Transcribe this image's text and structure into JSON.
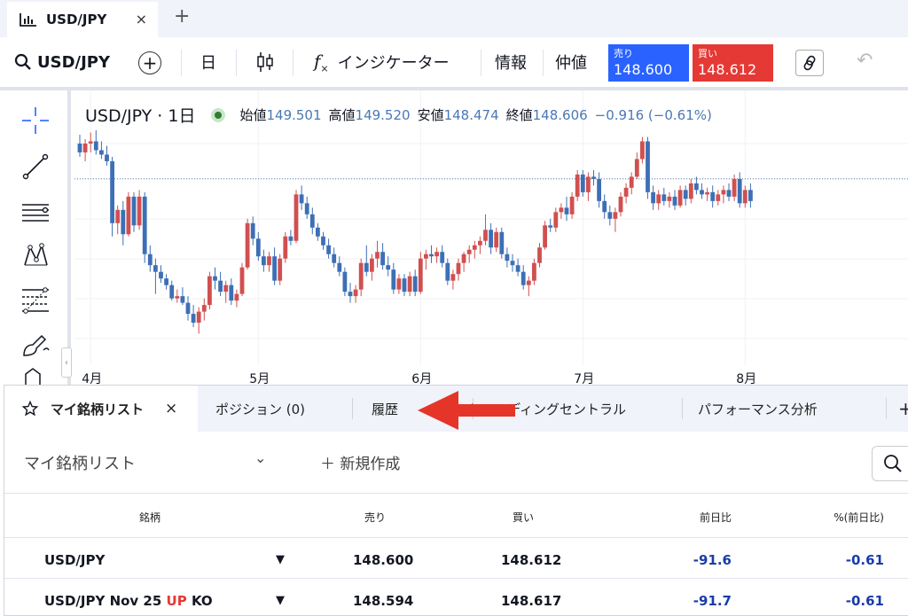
{
  "tab": {
    "title": "USD/JPY",
    "close": "×",
    "add": "+"
  },
  "toolbar": {
    "symbol": "USD/JPY",
    "add_symbol": "+",
    "interval": "日",
    "indicators": "インジケーター",
    "info": "情報",
    "mid": "仲値",
    "sell_label": "売り",
    "sell_price": "148.600",
    "buy_label": "買い",
    "buy_price": "148.612",
    "undo": "↶"
  },
  "legend": {
    "symbol": "USD/JPY · 1日",
    "open_label": "始値",
    "open": "149.501",
    "high_label": "高値",
    "high": "149.520",
    "low_label": "安値",
    "low": "148.474",
    "close_label": "終値",
    "close": "148.606",
    "change": "−0.916 (−0.61%)"
  },
  "colors": {
    "up": "#d0504f",
    "down": "#3d6fb6",
    "accent": "#2962ff",
    "sell_bg": "#2962ff",
    "buy_bg": "#e53935"
  },
  "chart_data": {
    "type": "candlestick",
    "x_tick_labels": [
      "4月",
      "5月",
      "6月",
      "7月",
      "8月"
    ],
    "x_tick_index": [
      2,
      33,
      63,
      93,
      123
    ],
    "price_line": 148.606,
    "ylim": [
      140.5,
      151.0
    ],
    "candles": [
      {
        "o": 150.2,
        "h": 150.6,
        "l": 149.6,
        "c": 149.8
      },
      {
        "o": 149.8,
        "h": 150.4,
        "l": 149.4,
        "c": 150.2
      },
      {
        "o": 150.2,
        "h": 150.7,
        "l": 149.8,
        "c": 150.3
      },
      {
        "o": 150.3,
        "h": 150.8,
        "l": 149.7,
        "c": 149.9
      },
      {
        "o": 149.9,
        "h": 150.3,
        "l": 149.5,
        "c": 149.7
      },
      {
        "o": 149.7,
        "h": 150.1,
        "l": 149.2,
        "c": 149.4
      },
      {
        "o": 149.4,
        "h": 149.6,
        "l": 146.0,
        "c": 146.6
      },
      {
        "o": 146.6,
        "h": 147.4,
        "l": 146.1,
        "c": 147.2
      },
      {
        "o": 147.2,
        "h": 147.6,
        "l": 145.6,
        "c": 146.1
      },
      {
        "o": 146.1,
        "h": 148.0,
        "l": 146.0,
        "c": 147.8
      },
      {
        "o": 147.8,
        "h": 148.0,
        "l": 146.2,
        "c": 146.5
      },
      {
        "o": 146.5,
        "h": 148.1,
        "l": 146.3,
        "c": 147.8
      },
      {
        "o": 147.8,
        "h": 148.0,
        "l": 144.8,
        "c": 145.2
      },
      {
        "o": 145.2,
        "h": 145.6,
        "l": 144.4,
        "c": 144.7
      },
      {
        "o": 144.7,
        "h": 145.0,
        "l": 143.4,
        "c": 144.4
      },
      {
        "o": 144.4,
        "h": 144.7,
        "l": 143.9,
        "c": 144.1
      },
      {
        "o": 144.1,
        "h": 144.3,
        "l": 143.6,
        "c": 143.8
      },
      {
        "o": 143.8,
        "h": 144.0,
        "l": 143.1,
        "c": 143.2
      },
      {
        "o": 143.2,
        "h": 143.6,
        "l": 143.0,
        "c": 143.3
      },
      {
        "o": 143.3,
        "h": 143.7,
        "l": 142.9,
        "c": 143.0
      },
      {
        "o": 143.0,
        "h": 143.3,
        "l": 142.2,
        "c": 142.5
      },
      {
        "o": 142.5,
        "h": 142.9,
        "l": 141.9,
        "c": 142.1
      },
      {
        "o": 142.1,
        "h": 142.8,
        "l": 141.6,
        "c": 142.6
      },
      {
        "o": 142.6,
        "h": 143.2,
        "l": 142.2,
        "c": 142.9
      },
      {
        "o": 142.9,
        "h": 144.4,
        "l": 142.7,
        "c": 144.2
      },
      {
        "o": 144.2,
        "h": 144.6,
        "l": 143.6,
        "c": 144.0
      },
      {
        "o": 144.0,
        "h": 144.4,
        "l": 143.3,
        "c": 143.5
      },
      {
        "o": 143.5,
        "h": 144.0,
        "l": 143.0,
        "c": 143.8
      },
      {
        "o": 143.8,
        "h": 144.1,
        "l": 142.9,
        "c": 143.1
      },
      {
        "o": 143.1,
        "h": 143.6,
        "l": 142.8,
        "c": 143.4
      },
      {
        "o": 143.4,
        "h": 144.8,
        "l": 143.3,
        "c": 144.6
      },
      {
        "o": 144.6,
        "h": 146.8,
        "l": 144.5,
        "c": 146.6
      },
      {
        "o": 146.6,
        "h": 146.9,
        "l": 145.6,
        "c": 145.9
      },
      {
        "o": 145.9,
        "h": 146.2,
        "l": 144.9,
        "c": 145.1
      },
      {
        "o": 145.1,
        "h": 145.4,
        "l": 144.4,
        "c": 144.7
      },
      {
        "o": 144.7,
        "h": 145.3,
        "l": 144.4,
        "c": 145.1
      },
      {
        "o": 145.1,
        "h": 145.5,
        "l": 143.8,
        "c": 144.0
      },
      {
        "o": 144.0,
        "h": 145.2,
        "l": 143.8,
        "c": 145.0
      },
      {
        "o": 145.0,
        "h": 146.2,
        "l": 144.8,
        "c": 146.0
      },
      {
        "o": 146.0,
        "h": 146.3,
        "l": 145.6,
        "c": 145.8
      },
      {
        "o": 145.8,
        "h": 148.1,
        "l": 145.7,
        "c": 147.9
      },
      {
        "o": 147.9,
        "h": 148.3,
        "l": 147.2,
        "c": 147.5
      },
      {
        "o": 147.5,
        "h": 147.8,
        "l": 146.8,
        "c": 147.0
      },
      {
        "o": 147.0,
        "h": 147.3,
        "l": 146.1,
        "c": 146.4
      },
      {
        "o": 146.4,
        "h": 146.6,
        "l": 145.8,
        "c": 146.0
      },
      {
        "o": 146.0,
        "h": 146.2,
        "l": 145.4,
        "c": 145.6
      },
      {
        "o": 145.6,
        "h": 145.9,
        "l": 145.0,
        "c": 145.2
      },
      {
        "o": 145.2,
        "h": 145.5,
        "l": 144.6,
        "c": 144.8
      },
      {
        "o": 144.8,
        "h": 145.1,
        "l": 144.2,
        "c": 144.4
      },
      {
        "o": 144.4,
        "h": 144.6,
        "l": 143.3,
        "c": 143.5
      },
      {
        "o": 143.5,
        "h": 143.9,
        "l": 143.0,
        "c": 143.3
      },
      {
        "o": 143.3,
        "h": 143.8,
        "l": 143.0,
        "c": 143.6
      },
      {
        "o": 143.6,
        "h": 145.0,
        "l": 143.3,
        "c": 144.8
      },
      {
        "o": 144.8,
        "h": 145.6,
        "l": 144.2,
        "c": 144.4
      },
      {
        "o": 144.4,
        "h": 145.2,
        "l": 144.0,
        "c": 145.0
      },
      {
        "o": 145.0,
        "h": 145.8,
        "l": 144.6,
        "c": 145.3
      },
      {
        "o": 145.3,
        "h": 145.7,
        "l": 144.5,
        "c": 144.7
      },
      {
        "o": 144.7,
        "h": 145.1,
        "l": 144.2,
        "c": 144.5
      },
      {
        "o": 144.5,
        "h": 144.8,
        "l": 143.4,
        "c": 143.6
      },
      {
        "o": 143.6,
        "h": 144.3,
        "l": 143.4,
        "c": 144.1
      },
      {
        "o": 144.1,
        "h": 144.3,
        "l": 143.3,
        "c": 143.5
      },
      {
        "o": 143.5,
        "h": 144.4,
        "l": 143.3,
        "c": 144.2
      },
      {
        "o": 144.2,
        "h": 144.5,
        "l": 143.3,
        "c": 143.5
      },
      {
        "o": 143.5,
        "h": 145.3,
        "l": 143.4,
        "c": 145.0
      },
      {
        "o": 145.0,
        "h": 145.4,
        "l": 144.5,
        "c": 145.2
      },
      {
        "o": 145.2,
        "h": 145.6,
        "l": 144.8,
        "c": 145.1
      },
      {
        "o": 145.1,
        "h": 145.5,
        "l": 144.8,
        "c": 145.3
      },
      {
        "o": 145.3,
        "h": 145.6,
        "l": 144.6,
        "c": 144.8
      },
      {
        "o": 144.8,
        "h": 145.0,
        "l": 143.8,
        "c": 144.0
      },
      {
        "o": 144.0,
        "h": 144.5,
        "l": 143.6,
        "c": 144.3
      },
      {
        "o": 144.3,
        "h": 145.0,
        "l": 144.0,
        "c": 144.8
      },
      {
        "o": 144.8,
        "h": 145.3,
        "l": 144.4,
        "c": 145.2
      },
      {
        "o": 145.2,
        "h": 145.6,
        "l": 144.8,
        "c": 145.4
      },
      {
        "o": 145.4,
        "h": 145.8,
        "l": 145.0,
        "c": 145.6
      },
      {
        "o": 145.6,
        "h": 146.0,
        "l": 145.2,
        "c": 145.8
      },
      {
        "o": 145.8,
        "h": 147.0,
        "l": 145.6,
        "c": 146.3
      },
      {
        "o": 146.3,
        "h": 146.6,
        "l": 145.2,
        "c": 145.5
      },
      {
        "o": 145.5,
        "h": 146.4,
        "l": 145.3,
        "c": 146.2
      },
      {
        "o": 146.2,
        "h": 146.4,
        "l": 145.0,
        "c": 145.2
      },
      {
        "o": 145.2,
        "h": 145.5,
        "l": 144.6,
        "c": 144.9
      },
      {
        "o": 144.9,
        "h": 145.2,
        "l": 144.4,
        "c": 144.7
      },
      {
        "o": 144.7,
        "h": 145.0,
        "l": 144.2,
        "c": 144.4
      },
      {
        "o": 144.4,
        "h": 144.7,
        "l": 143.6,
        "c": 143.8
      },
      {
        "o": 143.8,
        "h": 144.2,
        "l": 143.3,
        "c": 144.0
      },
      {
        "o": 144.0,
        "h": 145.0,
        "l": 143.8,
        "c": 144.8
      },
      {
        "o": 144.8,
        "h": 145.7,
        "l": 144.6,
        "c": 145.5
      },
      {
        "o": 145.5,
        "h": 146.7,
        "l": 145.4,
        "c": 146.5
      },
      {
        "o": 146.5,
        "h": 146.8,
        "l": 146.2,
        "c": 146.4
      },
      {
        "o": 146.4,
        "h": 147.3,
        "l": 146.2,
        "c": 147.1
      },
      {
        "o": 147.1,
        "h": 147.5,
        "l": 146.8,
        "c": 147.3
      },
      {
        "o": 147.3,
        "h": 147.8,
        "l": 146.7,
        "c": 147.0
      },
      {
        "o": 147.0,
        "h": 148.0,
        "l": 146.8,
        "c": 147.8
      },
      {
        "o": 147.8,
        "h": 149.0,
        "l": 147.6,
        "c": 148.8
      },
      {
        "o": 148.8,
        "h": 149.0,
        "l": 147.8,
        "c": 148.0
      },
      {
        "o": 148.0,
        "h": 148.9,
        "l": 147.6,
        "c": 148.7
      },
      {
        "o": 148.7,
        "h": 149.0,
        "l": 148.3,
        "c": 148.6
      },
      {
        "o": 148.6,
        "h": 148.9,
        "l": 147.3,
        "c": 147.6
      },
      {
        "o": 147.6,
        "h": 147.9,
        "l": 146.8,
        "c": 147.1
      },
      {
        "o": 147.1,
        "h": 147.4,
        "l": 146.5,
        "c": 146.8
      },
      {
        "o": 146.8,
        "h": 147.3,
        "l": 146.2,
        "c": 147.1
      },
      {
        "o": 147.1,
        "h": 148.0,
        "l": 146.9,
        "c": 147.8
      },
      {
        "o": 147.8,
        "h": 148.4,
        "l": 147.5,
        "c": 148.2
      },
      {
        "o": 148.2,
        "h": 148.9,
        "l": 147.9,
        "c": 148.7
      },
      {
        "o": 148.7,
        "h": 149.8,
        "l": 148.6,
        "c": 149.5
      },
      {
        "o": 149.5,
        "h": 150.5,
        "l": 149.3,
        "c": 150.3
      },
      {
        "o": 150.3,
        "h": 150.5,
        "l": 147.7,
        "c": 148.0
      },
      {
        "o": 148.0,
        "h": 148.3,
        "l": 147.2,
        "c": 147.5
      },
      {
        "o": 147.5,
        "h": 148.1,
        "l": 147.2,
        "c": 147.9
      },
      {
        "o": 147.9,
        "h": 148.2,
        "l": 147.4,
        "c": 147.6
      },
      {
        "o": 147.6,
        "h": 148.0,
        "l": 147.3,
        "c": 147.8
      },
      {
        "o": 147.8,
        "h": 148.1,
        "l": 147.2,
        "c": 147.4
      },
      {
        "o": 147.4,
        "h": 148.3,
        "l": 147.3,
        "c": 148.1
      },
      {
        "o": 148.1,
        "h": 148.3,
        "l": 147.4,
        "c": 147.7
      },
      {
        "o": 147.7,
        "h": 148.6,
        "l": 147.5,
        "c": 148.4
      },
      {
        "o": 148.4,
        "h": 148.7,
        "l": 147.9,
        "c": 148.1
      },
      {
        "o": 148.1,
        "h": 148.4,
        "l": 147.7,
        "c": 147.9
      },
      {
        "o": 147.9,
        "h": 148.2,
        "l": 147.6,
        "c": 148.0
      },
      {
        "o": 148.0,
        "h": 148.3,
        "l": 147.3,
        "c": 147.6
      },
      {
        "o": 147.6,
        "h": 148.1,
        "l": 147.4,
        "c": 147.9
      },
      {
        "o": 147.9,
        "h": 148.3,
        "l": 147.5,
        "c": 148.1
      },
      {
        "o": 148.1,
        "h": 148.4,
        "l": 147.6,
        "c": 147.8
      },
      {
        "o": 147.8,
        "h": 148.8,
        "l": 147.6,
        "c": 148.6
      },
      {
        "o": 148.6,
        "h": 148.9,
        "l": 147.3,
        "c": 147.5
      },
      {
        "o": 147.5,
        "h": 148.3,
        "l": 147.3,
        "c": 148.1
      },
      {
        "o": 148.1,
        "h": 148.4,
        "l": 147.3,
        "c": 147.6
      }
    ]
  },
  "panel": {
    "tabs": {
      "watchlist": "マイ銘柄リスト",
      "watchlist_close": "×",
      "positions": "ポジション (0)",
      "history": "履歴",
      "trading_central": "トレーディングセントラル",
      "performance": "パフォーマンス分析",
      "more": "+"
    },
    "watchlist_title": "マイ銘柄リスト",
    "chevron": "⌄",
    "new_create": "＋ 新規作成",
    "columns": {
      "symbol": "銘柄",
      "sell": "売り",
      "buy": "買い",
      "change": "前日比",
      "pct": "%(前日比)"
    },
    "rows": [
      {
        "name": "USD/JPY",
        "name_up": "",
        "name_tail": "",
        "trend": "▼",
        "sell": "148.600",
        "buy": "148.612",
        "change": "-91.6",
        "pct": "-0.61"
      },
      {
        "name": "USD/JPY Nov 25 ",
        "name_up": "UP",
        "name_tail": " KO",
        "trend": "▼",
        "sell": "148.594",
        "buy": "148.617",
        "change": "-91.7",
        "pct": "-0.61"
      }
    ]
  }
}
